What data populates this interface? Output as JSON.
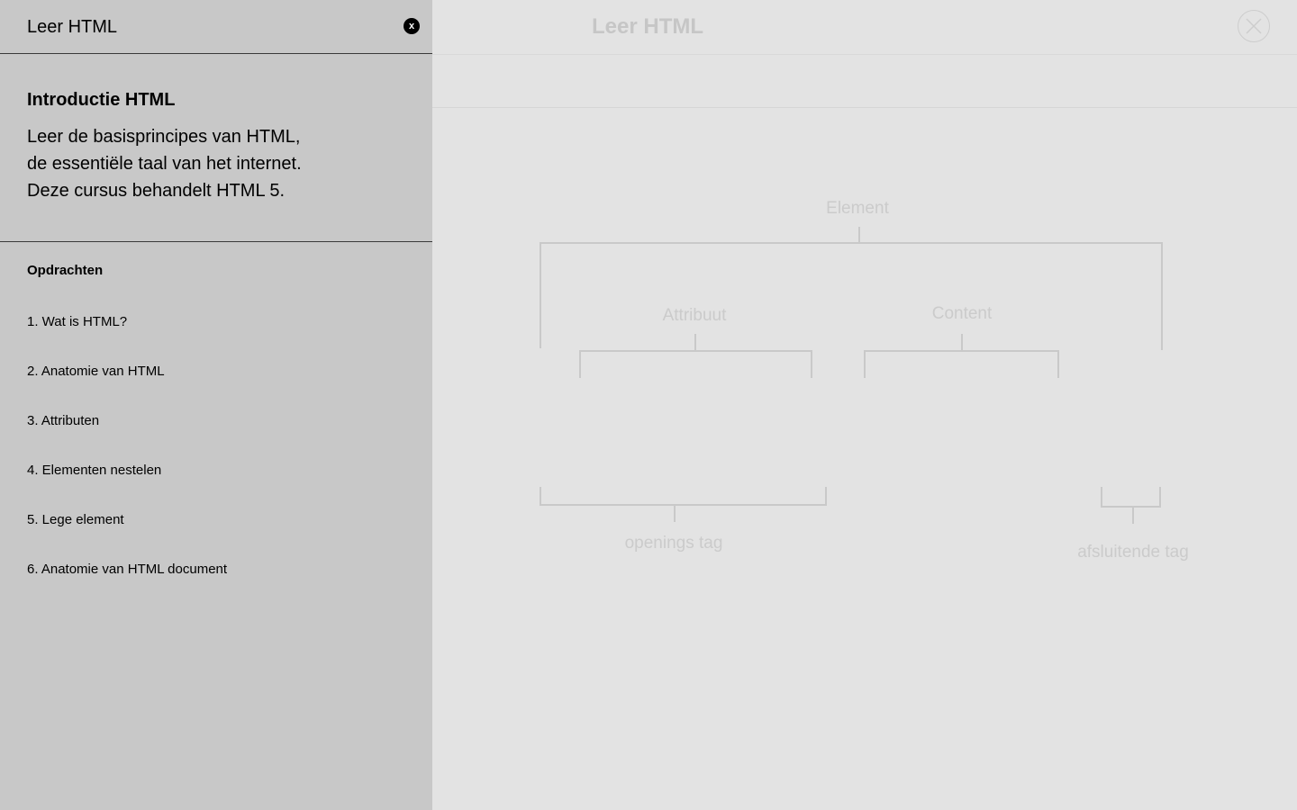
{
  "main": {
    "title": "Leer HTML",
    "close_icon": "x-circle-icon",
    "diagram": {
      "element_label": "Element",
      "attribute_label": "Attribuut",
      "content_label": "Content",
      "opening_tag_label": "openings tag",
      "closing_tag_label": "afsluitende tag"
    }
  },
  "sidebar": {
    "title": "Leer HTML",
    "close_label": "x",
    "intro": {
      "heading": "Introductie HTML",
      "lines": [
        "Leer de basisprincipes van HTML,",
        "de essentiële taal van het internet.",
        "Deze cursus behandelt HTML 5."
      ]
    },
    "tasks_title": "Opdrachten",
    "tasks": [
      "1. Wat is HTML?",
      "2. Anatomie van HTML",
      "3. Attributen",
      "4. Elementen nestelen",
      "5. Lege element",
      "6. Anatomie van HTML document"
    ]
  },
  "colors": {
    "sidebar_bg": "#c8c8c8",
    "main_bg": "#e3e3e3",
    "dimmed_text": "#c6c6c6"
  }
}
